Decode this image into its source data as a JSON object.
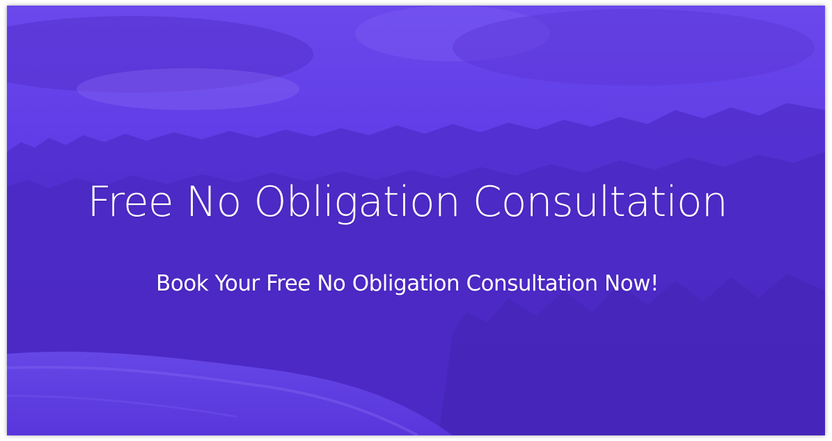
{
  "hero": {
    "title": "Free No Obligation Consultation",
    "subtitle": "Book Your Free No Obligation Consultation Now!",
    "overlay_color": "#5a34e0",
    "background_image": "forest-landscape-photo"
  }
}
